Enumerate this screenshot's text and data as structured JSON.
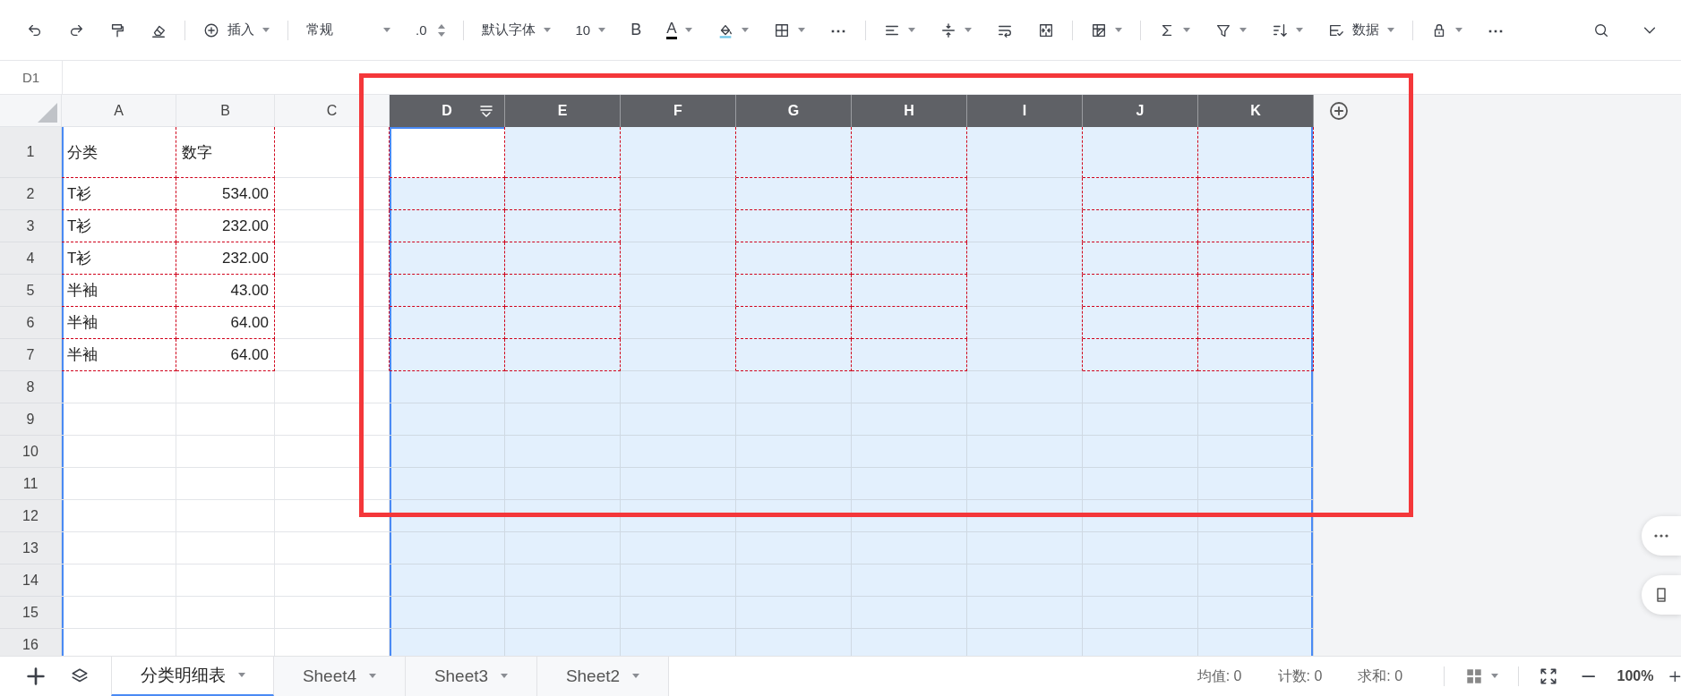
{
  "toolbar": {
    "groups": [
      [
        {
          "kind": "undo",
          "dropdown": false
        },
        {
          "kind": "redo",
          "dropdown": false
        },
        {
          "kind": "painter",
          "dropdown": false
        },
        {
          "kind": "eraser",
          "dropdown": false
        }
      ],
      [
        {
          "kind": "insert",
          "label": "插入",
          "dropdown": true
        }
      ],
      [
        {
          "kind": "format",
          "label": "常规",
          "dropdown": true
        },
        {
          "kind": "decimal",
          "label": ".0",
          "dropdown": false
        }
      ],
      [
        {
          "kind": "font",
          "label": "默认字体",
          "dropdown": true
        },
        {
          "kind": "size",
          "label": "10",
          "dropdown": true
        },
        {
          "kind": "bold",
          "label": "B",
          "dropdown": false
        },
        {
          "kind": "fontcolor",
          "label": "A",
          "dropdown": true
        },
        {
          "kind": "fill",
          "dropdown": true
        },
        {
          "kind": "borders",
          "dropdown": true
        },
        {
          "kind": "more",
          "label": "⋯",
          "dropdown": false
        }
      ],
      [
        {
          "kind": "align",
          "dropdown": true
        },
        {
          "kind": "valign",
          "dropdown": true
        },
        {
          "kind": "wrap",
          "dropdown": false
        },
        {
          "kind": "merge",
          "dropdown": false
        }
      ],
      [
        {
          "kind": "freeze",
          "dropdown": true
        }
      ],
      [
        {
          "kind": "sum",
          "dropdown": true
        },
        {
          "kind": "filter",
          "dropdown": true
        },
        {
          "kind": "sort",
          "dropdown": true
        },
        {
          "kind": "data",
          "label": "数据",
          "dropdown": true
        }
      ],
      [
        {
          "kind": "lock",
          "dropdown": true
        },
        {
          "kind": "more",
          "label": "⋯",
          "dropdown": false
        }
      ]
    ],
    "right": [
      {
        "kind": "search",
        "dropdown": false
      },
      {
        "kind": "collapse",
        "dropdown": false
      }
    ]
  },
  "name_box": "D1",
  "grid": {
    "columns": [
      {
        "label": "A",
        "selected": false,
        "bordered": true,
        "filter": false
      },
      {
        "label": "B",
        "selected": false,
        "bordered": true,
        "filter": false
      },
      {
        "label": "C",
        "selected": false,
        "bordered": false,
        "filter": false
      },
      {
        "label": "D",
        "selected": true,
        "bordered": true,
        "filter": true
      },
      {
        "label": "E",
        "selected": true,
        "bordered": true,
        "filter": false
      },
      {
        "label": "F",
        "selected": true,
        "bordered": false,
        "filter": false
      },
      {
        "label": "G",
        "selected": true,
        "bordered": true,
        "filter": false
      },
      {
        "label": "H",
        "selected": true,
        "bordered": true,
        "filter": false
      },
      {
        "label": "I",
        "selected": true,
        "bordered": false,
        "filter": false
      },
      {
        "label": "J",
        "selected": true,
        "bordered": true,
        "filter": false
      },
      {
        "label": "K",
        "selected": true,
        "bordered": true,
        "filter": false
      }
    ],
    "rows": [
      {
        "header": "1",
        "bordered": true,
        "cells": [
          {
            "kind": "text",
            "text": "分类",
            "active": false
          },
          {
            "kind": "text",
            "text": "数字",
            "active": false
          },
          {
            "kind": "empty",
            "active": false
          },
          {
            "kind": "empty",
            "active": true
          }
        ]
      },
      {
        "header": "2",
        "bordered": true,
        "cells": [
          {
            "kind": "text",
            "text": "T衫",
            "active": false
          },
          {
            "kind": "number",
            "text": "534.00",
            "active": false
          }
        ]
      },
      {
        "header": "3",
        "bordered": true,
        "cells": [
          {
            "kind": "text",
            "text": "T衫",
            "active": false
          },
          {
            "kind": "number",
            "text": "232.00",
            "active": false
          }
        ]
      },
      {
        "header": "4",
        "bordered": true,
        "cells": [
          {
            "kind": "text",
            "text": "T衫",
            "active": false
          },
          {
            "kind": "number",
            "text": "232.00",
            "active": false
          }
        ]
      },
      {
        "header": "5",
        "bordered": true,
        "cells": [
          {
            "kind": "text",
            "text": "半袖",
            "active": false
          },
          {
            "kind": "number",
            "text": "43.00",
            "active": false
          }
        ]
      },
      {
        "header": "6",
        "bordered": true,
        "cells": [
          {
            "kind": "text",
            "text": "半袖",
            "active": false
          },
          {
            "kind": "number",
            "text": "64.00",
            "active": false
          }
        ]
      },
      {
        "header": "7",
        "bordered": true,
        "cells": [
          {
            "kind": "text",
            "text": "半袖",
            "active": false
          },
          {
            "kind": "number",
            "text": "64.00",
            "active": false
          }
        ]
      },
      {
        "header": "8",
        "bordered": false
      },
      {
        "header": "9",
        "bordered": false
      },
      {
        "header": "10",
        "bordered": false
      },
      {
        "header": "11",
        "bordered": false
      },
      {
        "header": "12",
        "bordered": false
      },
      {
        "header": "13",
        "bordered": false
      },
      {
        "header": "14",
        "bordered": false
      },
      {
        "header": "15",
        "bordered": false
      },
      {
        "header": "16",
        "bordered": false
      }
    ]
  },
  "highlight_frame": true,
  "float_buttons": [
    {
      "kind": "more"
    },
    {
      "kind": "tablet"
    }
  ],
  "sheet_bar": {
    "actions": [
      {
        "kind": "add"
      },
      {
        "kind": "layers"
      }
    ],
    "tabs": [
      {
        "label": "分类明细表",
        "selected": true
      },
      {
        "label": "Sheet4",
        "selected": false
      },
      {
        "label": "Sheet3",
        "selected": false
      },
      {
        "label": "Sheet2",
        "selected": false
      }
    ],
    "stats": [
      "均值: 0",
      "计数: 0",
      "求和: 0"
    ],
    "controls": [
      {
        "kind": "view",
        "dropdown": true
      },
      {
        "kind": "fullscreen",
        "dropdown": false
      },
      {
        "kind": "zoomout",
        "dropdown": false
      }
    ],
    "zoom": "100%",
    "zoom_in": true
  }
}
